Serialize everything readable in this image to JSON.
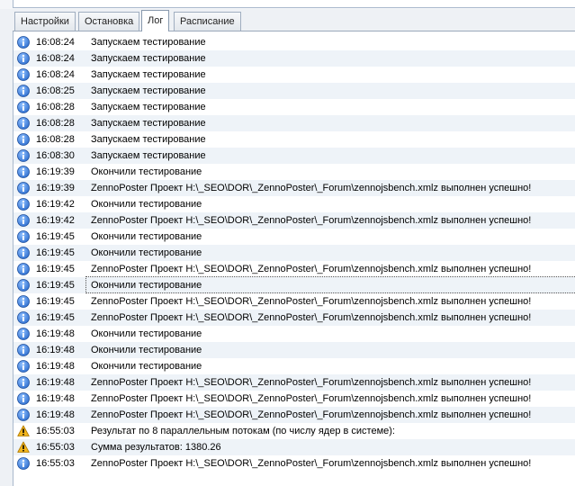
{
  "tabs": [
    {
      "label": "Настройки"
    },
    {
      "label": "Остановка"
    },
    {
      "label": "Лог"
    },
    {
      "label": "Расписание"
    }
  ],
  "active_tab": 2,
  "colors": {
    "info_icon": "#2f6fcf",
    "warning_icon": "#f2b51c"
  },
  "log": [
    {
      "type": "info-icon",
      "time": "16:08:24",
      "text": "Запускаем тестирование"
    },
    {
      "type": "info-icon",
      "time": "16:08:24",
      "text": "Запускаем тестирование"
    },
    {
      "type": "info-icon",
      "time": "16:08:24",
      "text": "Запускаем тестирование"
    },
    {
      "type": "info-icon",
      "time": "16:08:25",
      "text": "Запускаем тестирование"
    },
    {
      "type": "info-icon",
      "time": "16:08:28",
      "text": "Запускаем тестирование"
    },
    {
      "type": "info-icon",
      "time": "16:08:28",
      "text": "Запускаем тестирование"
    },
    {
      "type": "info-icon",
      "time": "16:08:28",
      "text": "Запускаем тестирование"
    },
    {
      "type": "info-icon",
      "time": "16:08:30",
      "text": "Запускаем тестирование"
    },
    {
      "type": "info-icon",
      "time": "16:19:39",
      "text": "Окончили тестирование"
    },
    {
      "type": "info-icon",
      "time": "16:19:39",
      "text": "ZennoPoster Проект H:\\_SEO\\DOR\\_ZennoPoster\\_Forum\\zennojsbench.xmlz выполнен успешно!"
    },
    {
      "type": "info-icon",
      "time": "16:19:42",
      "text": "Окончили тестирование"
    },
    {
      "type": "info-icon",
      "time": "16:19:42",
      "text": "ZennoPoster Проект H:\\_SEO\\DOR\\_ZennoPoster\\_Forum\\zennojsbench.xmlz выполнен успешно!"
    },
    {
      "type": "info-icon",
      "time": "16:19:45",
      "text": "Окончили тестирование"
    },
    {
      "type": "info-icon",
      "time": "16:19:45",
      "text": "Окончили тестирование"
    },
    {
      "type": "info-icon",
      "time": "16:19:45",
      "text": "ZennoPoster Проект H:\\_SEO\\DOR\\_ZennoPoster\\_Forum\\zennojsbench.xmlz выполнен успешно!"
    },
    {
      "type": "info-icon",
      "time": "16:19:45",
      "text": "Окончили тестирование",
      "selected": true
    },
    {
      "type": "info-icon",
      "time": "16:19:45",
      "text": "ZennoPoster Проект H:\\_SEO\\DOR\\_ZennoPoster\\_Forum\\zennojsbench.xmlz выполнен успешно!"
    },
    {
      "type": "info-icon",
      "time": "16:19:45",
      "text": "ZennoPoster Проект H:\\_SEO\\DOR\\_ZennoPoster\\_Forum\\zennojsbench.xmlz выполнен успешно!"
    },
    {
      "type": "info-icon",
      "time": "16:19:48",
      "text": "Окончили тестирование"
    },
    {
      "type": "info-icon",
      "time": "16:19:48",
      "text": "Окончили тестирование"
    },
    {
      "type": "info-icon",
      "time": "16:19:48",
      "text": "Окончили тестирование"
    },
    {
      "type": "info-icon",
      "time": "16:19:48",
      "text": "ZennoPoster Проект H:\\_SEO\\DOR\\_ZennoPoster\\_Forum\\zennojsbench.xmlz выполнен успешно!"
    },
    {
      "type": "info-icon",
      "time": "16:19:48",
      "text": "ZennoPoster Проект H:\\_SEO\\DOR\\_ZennoPoster\\_Forum\\zennojsbench.xmlz выполнен успешно!"
    },
    {
      "type": "info-icon",
      "time": "16:19:48",
      "text": "ZennoPoster Проект H:\\_SEO\\DOR\\_ZennoPoster\\_Forum\\zennojsbench.xmlz выполнен успешно!"
    },
    {
      "type": "warning-icon",
      "time": "16:55:03",
      "text": "Результат по 8 параллельным потокам (по числу ядер в системе):"
    },
    {
      "type": "warning-icon",
      "time": "16:55:03",
      "text": " Сумма результатов: 1380.26"
    },
    {
      "type": "info-icon",
      "time": "16:55:03",
      "text": "ZennoPoster Проект H:\\_SEO\\DOR\\_ZennoPoster\\_Forum\\zennojsbench.xmlz выполнен успешно!"
    }
  ]
}
